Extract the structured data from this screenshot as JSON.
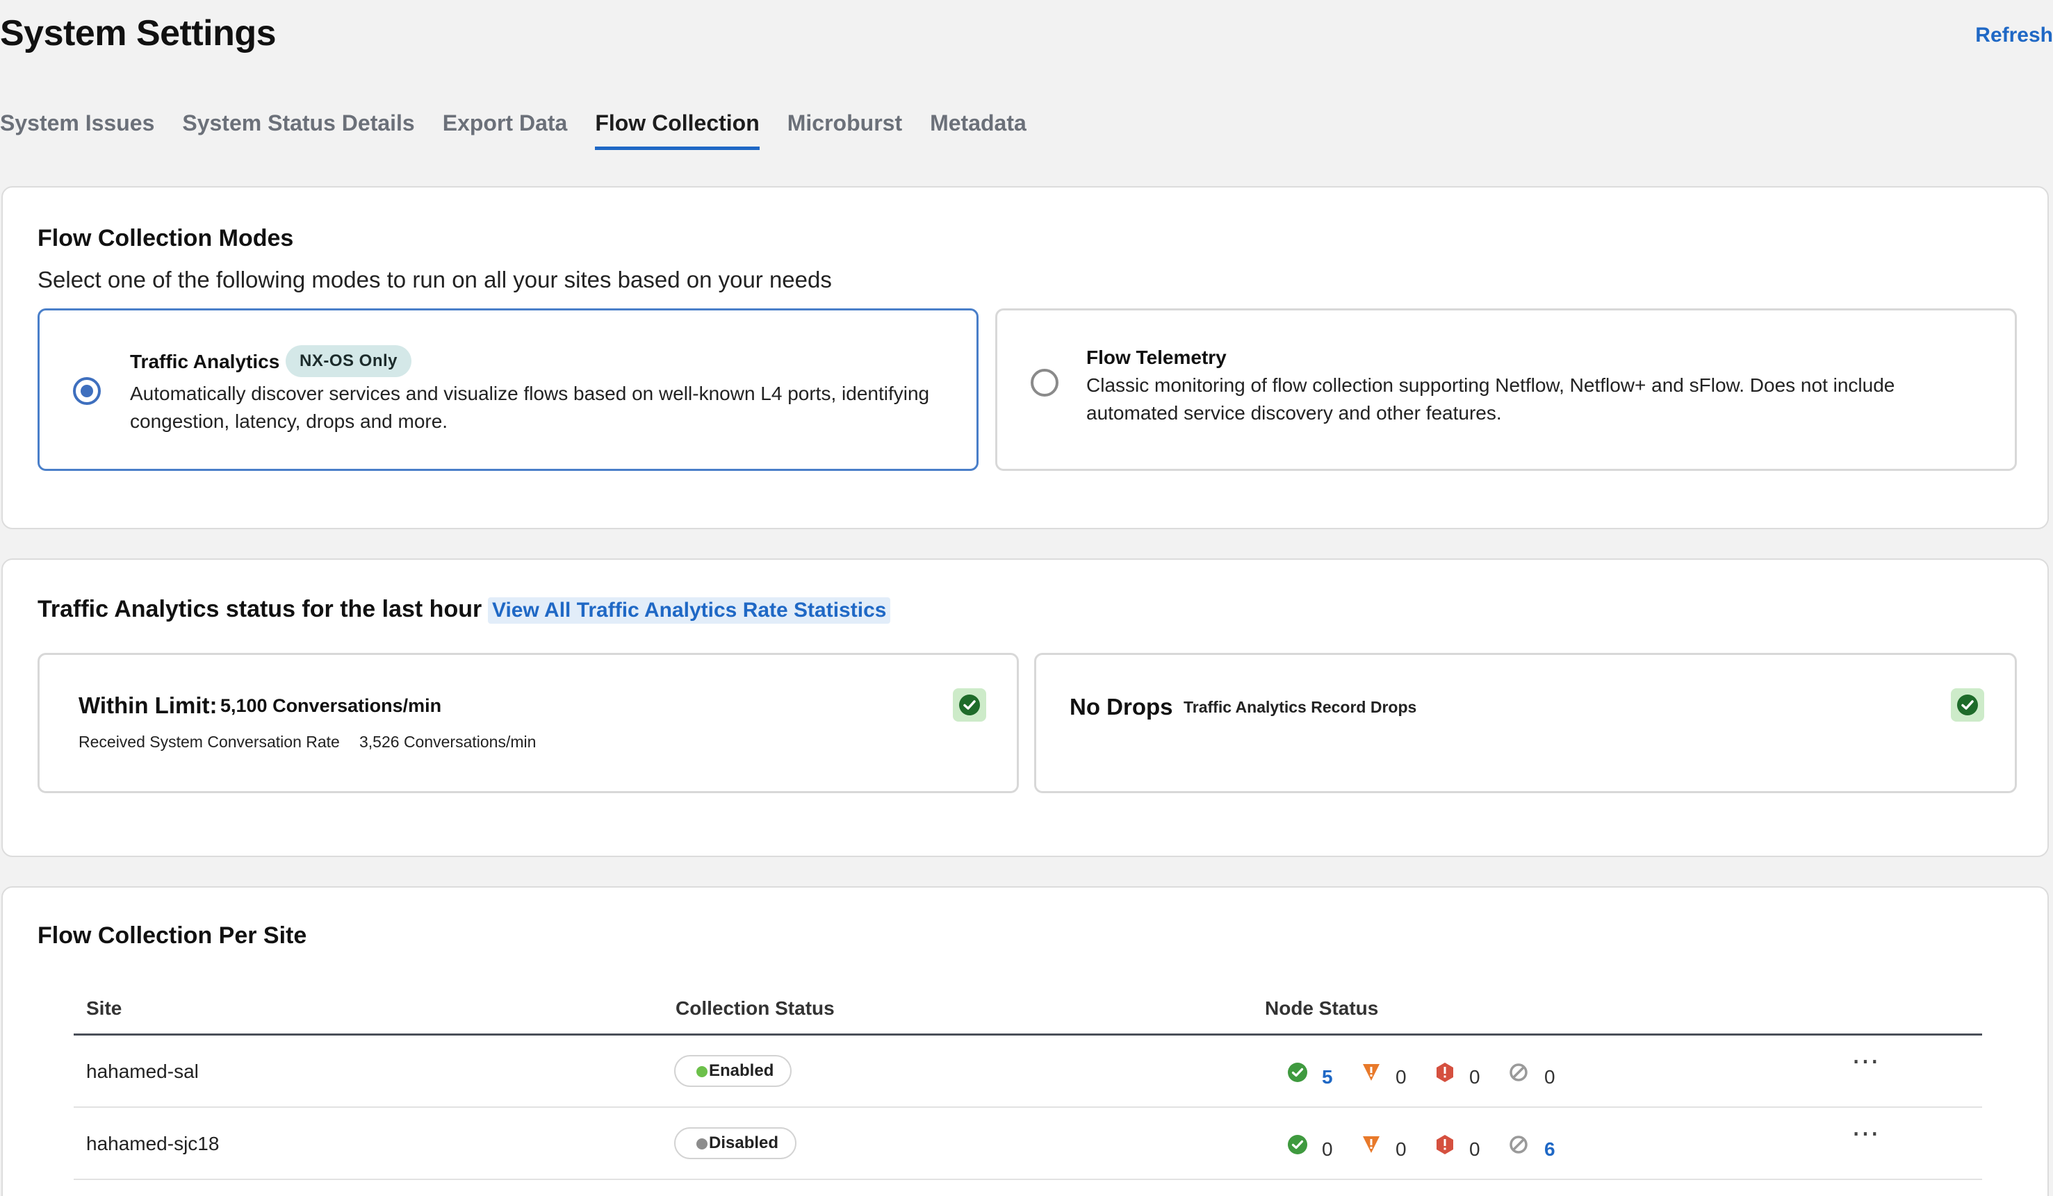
{
  "header": {
    "title": "System Settings",
    "refresh_label": "Refresh"
  },
  "tabs": [
    {
      "label": "System Issues",
      "active": false
    },
    {
      "label": "System Status Details",
      "active": false
    },
    {
      "label": "Export Data",
      "active": false
    },
    {
      "label": "Flow Collection",
      "active": true
    },
    {
      "label": "Microburst",
      "active": false
    },
    {
      "label": "Metadata",
      "active": false
    }
  ],
  "modes": {
    "title": "Flow Collection Modes",
    "subtitle": "Select one of the following modes to run on all your sites based on your needs",
    "options": [
      {
        "title": "Traffic Analytics",
        "badge": "NX-OS Only",
        "description_line1": "Automatically discover services and visualize flows based on well-known L4 ports, identifying",
        "description_line2": "congestion, latency, drops and more.",
        "selected": true
      },
      {
        "title": "Flow Telemetry",
        "description_line1": "Classic monitoring of flow collection supporting Netflow, Netflow+ and sFlow. Does not include",
        "description_line2": "automated service discovery and other features.",
        "selected": false
      }
    ]
  },
  "status": {
    "title": "Traffic Analytics status for the last hour",
    "link_label": "View All Traffic Analytics Rate Statistics",
    "limit": {
      "label": "Within Limit:",
      "value": "5,100 Conversations/min",
      "received_label": "Received System Conversation Rate",
      "received_value": "3,526 Conversations/min",
      "icon": "check-circle-icon"
    },
    "drops": {
      "label": "No Drops",
      "sublabel": "Traffic Analytics Record Drops",
      "icon": "check-circle-icon"
    }
  },
  "sites": {
    "title": "Flow Collection Per Site",
    "columns": [
      "Site",
      "Collection Status",
      "Node Status"
    ],
    "rows": [
      {
        "site": "hahamed-sal",
        "status": "Enabled",
        "status_color": "#6cc04a",
        "healthy": "5",
        "warning": "0",
        "critical": "0",
        "disabled": "0"
      },
      {
        "site": "hahamed-sjc18",
        "status": "Disabled",
        "status_color": "#8c8c8c",
        "healthy": "0",
        "warning": "0",
        "critical": "0",
        "disabled": "6"
      }
    ],
    "more_label": "⋯"
  },
  "colors": {
    "accent": "#1f68c5",
    "healthy": "#3f9a3f",
    "warning": "#e8792a",
    "critical": "#d5503f",
    "disabled": "#9a9a9a"
  }
}
